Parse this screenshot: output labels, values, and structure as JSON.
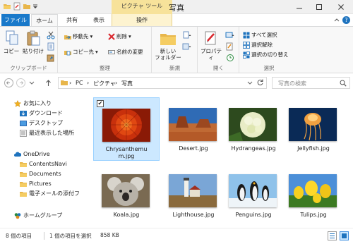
{
  "window": {
    "title": "写真",
    "context_tab_header": "ピクチャ ツール"
  },
  "tabs": {
    "file": "ファイル",
    "home": "ホーム",
    "share": "共有",
    "view": "表示",
    "manage": "操作"
  },
  "ribbon": {
    "clipboard": {
      "label": "クリップボード",
      "copy": "コピー",
      "paste": "貼り付け"
    },
    "organize": {
      "label": "整理",
      "move_to": "移動先",
      "copy_to": "コピー先",
      "delete": "削除",
      "rename": "名前の変更"
    },
    "new": {
      "label": "新規",
      "new_folder_line1": "新しい",
      "new_folder_line2": "フォルダー"
    },
    "open": {
      "label": "開く",
      "properties": "プロパティ"
    },
    "select": {
      "label": "選択",
      "select_all": "すべて選択",
      "select_none": "選択解除",
      "invert_selection": "選択の切り替え"
    }
  },
  "address": {
    "crumbs": [
      "PC",
      "ピクチャ",
      "写真"
    ],
    "separator": "›",
    "search_placeholder": "写真の検索"
  },
  "navigation": {
    "favorites": "お気に入り",
    "downloads": "ダウンロード",
    "desktop": "デスクトップ",
    "recent_places": "最近表示した場所",
    "onedrive": "OneDrive",
    "onedrive_items": [
      "ContentsNavi",
      "Documents",
      "Pictures",
      "電子メールの添付ファ"
    ],
    "homegroup": "ホームグループ"
  },
  "files": [
    {
      "name": "Chrysanthemum.jpg",
      "label_line1": "Chrysanthemu",
      "label_line2": "m.jpg",
      "selected": true,
      "checked": "✔"
    },
    {
      "name": "Desert.jpg",
      "label_line1": "Desert.jpg",
      "label_line2": "",
      "selected": false
    },
    {
      "name": "Hydrangeas.jpg",
      "label_line1": "Hydrangeas.jpg",
      "label_line2": "",
      "selected": false
    },
    {
      "name": "Jellyfish.jpg",
      "label_line1": "Jellyfish.jpg",
      "label_line2": "",
      "selected": false
    },
    {
      "name": "Koala.jpg",
      "label_line1": "Koala.jpg",
      "label_line2": "",
      "selected": false
    },
    {
      "name": "Lighthouse.jpg",
      "label_line1": "Lighthouse.jpg",
      "label_line2": "",
      "selected": false
    },
    {
      "name": "Penguins.jpg",
      "label_line1": "Penguins.jpg",
      "label_line2": "",
      "selected": false
    },
    {
      "name": "Tulips.jpg",
      "label_line1": "Tulips.jpg",
      "label_line2": "",
      "selected": false
    }
  ],
  "status": {
    "item_count": "8 個の項目",
    "selection": "1 個の項目を選択",
    "size": "858 KB"
  },
  "colors": {
    "file_tab": "#1979ca",
    "context_tab": "#f7e29a",
    "selection_bg": "#cce8ff",
    "selection_border": "#99d1ff",
    "close_hover": "#e81123"
  },
  "icons": {
    "folder": "folder-icon",
    "star": "star-icon",
    "cloud": "onedrive-cloud-icon",
    "homegroup": "homegroup-icon"
  }
}
